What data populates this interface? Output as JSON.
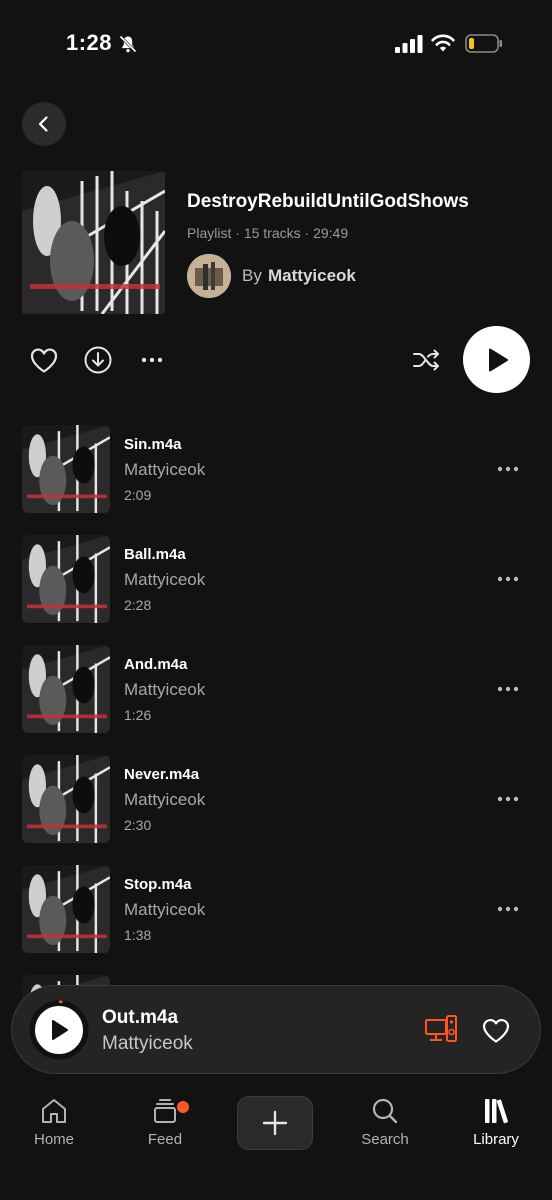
{
  "status_bar": {
    "time": "1:28",
    "icons": [
      "bell-off-icon",
      "signal-icon",
      "wifi-icon",
      "battery-low-icon"
    ],
    "battery_color": "#f5c518"
  },
  "nav": {
    "back_icon": "chevron-left-icon"
  },
  "playlist": {
    "title": "DestroyRebuildUntilGodShows",
    "type": "Playlist",
    "tracks_count": "15 tracks",
    "duration": "29:49",
    "by_label": "By",
    "owner": "Mattyiceok"
  },
  "actions": {
    "icons": [
      "heart-icon",
      "download-icon",
      "more-icon",
      "shuffle-icon",
      "play-icon"
    ]
  },
  "tracks": [
    {
      "title": "Sin.m4a",
      "artist": "Mattyiceok",
      "duration": "2:09"
    },
    {
      "title": "Ball.m4a",
      "artist": "Mattyiceok",
      "duration": "2:28"
    },
    {
      "title": "And.m4a",
      "artist": "Mattyiceok",
      "duration": "1:26"
    },
    {
      "title": "Never.m4a",
      "artist": "Mattyiceok",
      "duration": "2:30"
    },
    {
      "title": "Stop.m4a",
      "artist": "Mattyiceok",
      "duration": "1:38"
    }
  ],
  "now_playing": {
    "title": "Out.m4a",
    "artist": "Mattyiceok",
    "accent_color": "#ff5722"
  },
  "tab_bar": {
    "home": "Home",
    "feed": "Feed",
    "search": "Search",
    "library": "Library",
    "active": "library"
  }
}
